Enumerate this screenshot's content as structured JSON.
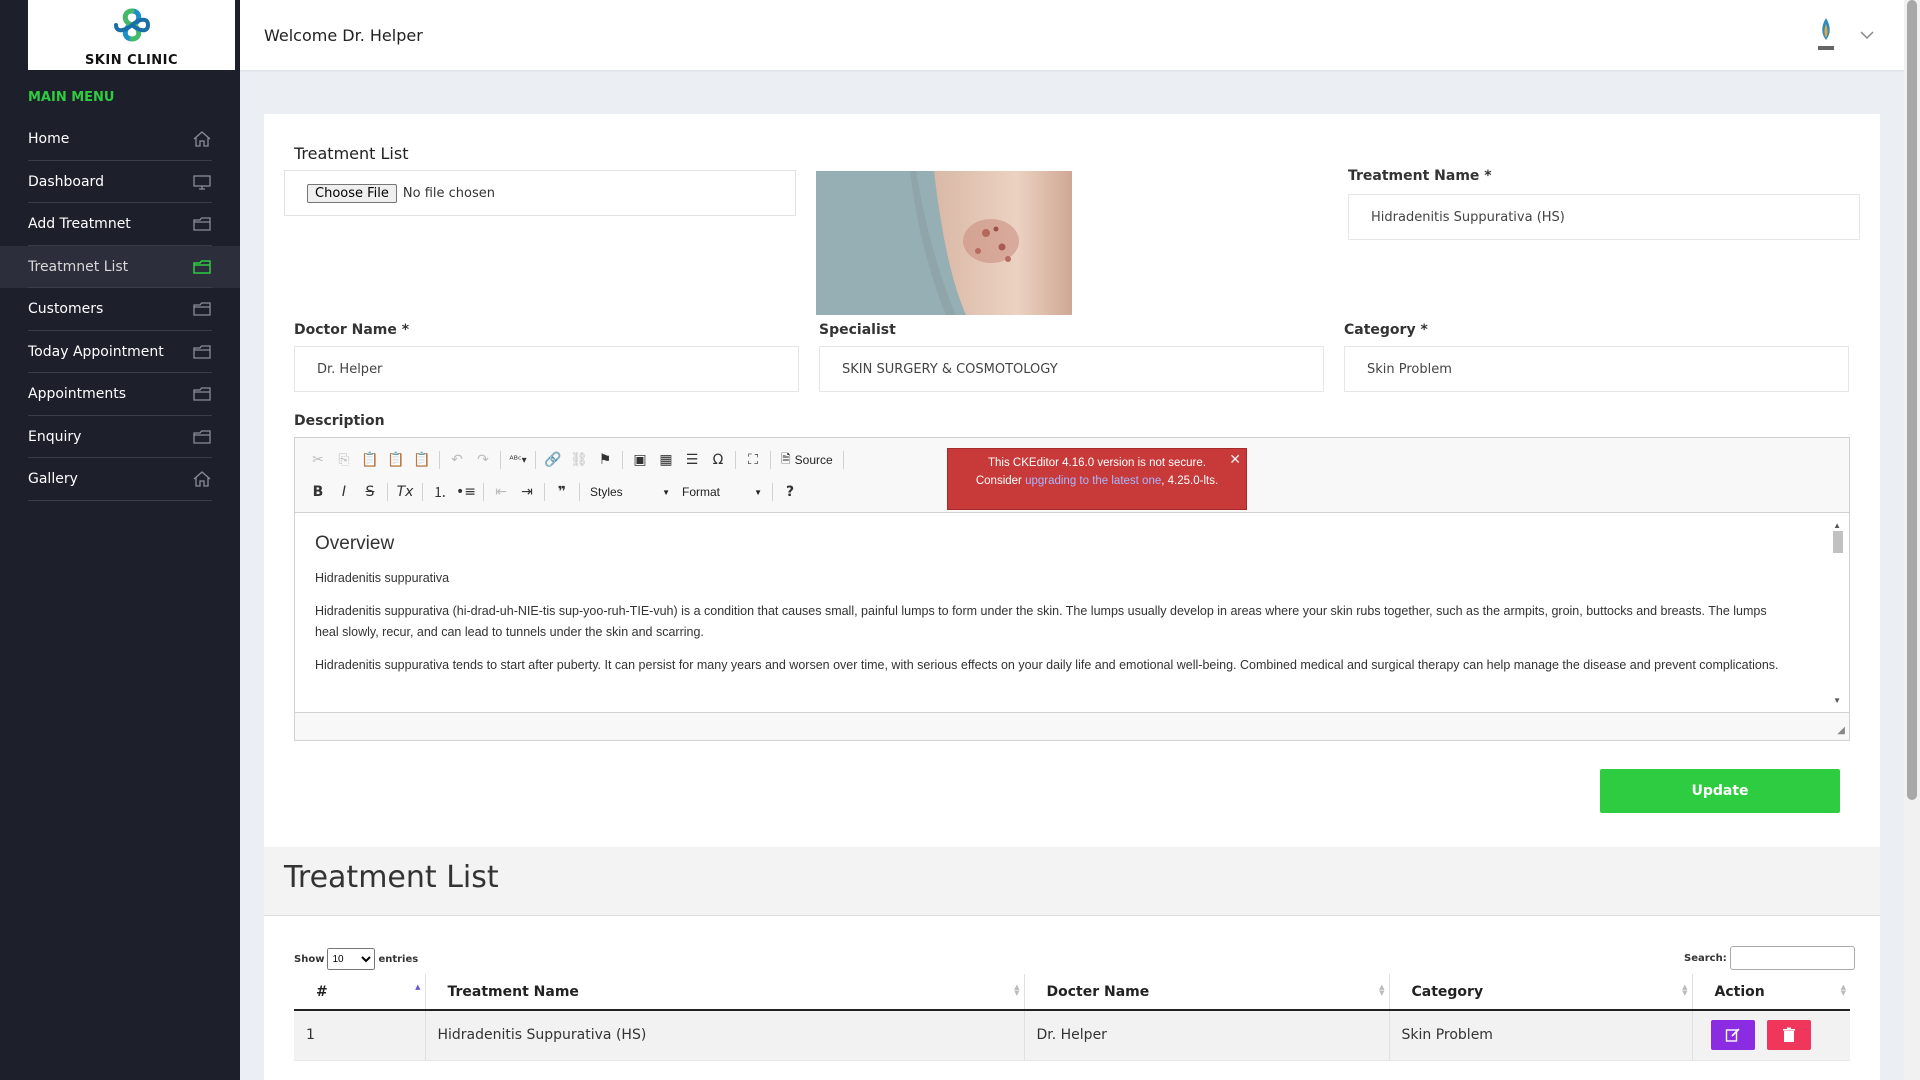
{
  "brand": {
    "name": "SKIN CLINIC"
  },
  "sidebar": {
    "heading": "MAIN MENU",
    "items": [
      {
        "label": "Home",
        "icon": "home-icon"
      },
      {
        "label": "Dashboard",
        "icon": "monitor-icon"
      },
      {
        "label": "Add Treatmnet",
        "icon": "folder-icon"
      },
      {
        "label": "Treatmnet List",
        "icon": "folder-icon",
        "active": true
      },
      {
        "label": "Customers",
        "icon": "folder-icon"
      },
      {
        "label": "Today Appointment",
        "icon": "folder-icon"
      },
      {
        "label": "Appointments",
        "icon": "folder-icon"
      },
      {
        "label": "Enquiry",
        "icon": "folder-icon"
      },
      {
        "label": "Gallery",
        "icon": "home-icon"
      }
    ]
  },
  "header": {
    "welcome": "Welcome Dr. Helper"
  },
  "form": {
    "section_title": "Treatment List",
    "file": {
      "button": "Choose File",
      "status": "No file chosen"
    },
    "treatment_name": {
      "label": "Treatment Name *",
      "value": "Hidradenitis Suppurativa (HS)"
    },
    "doctor_name": {
      "label": "Doctor Name *",
      "value": "Dr. Helper"
    },
    "specialist": {
      "label": "Specialist",
      "value": "SKIN SURGERY & COSMOTOLOGY"
    },
    "category": {
      "label": "Category *",
      "value": "Skin Problem"
    },
    "description": {
      "label": "Description",
      "toolbar": {
        "source": "Source",
        "styles": "Styles",
        "format": "Format"
      },
      "heading": "Overview",
      "paragraphs": [
        "Hidradenitis suppurativa",
        "Hidradenitis suppurativa (hi-drad-uh-NIE-tis sup-yoo-ruh-TIE-vuh) is a condition that causes small, painful lumps to form under the skin. The lumps usually develop in areas where your skin rubs together, such as the armpits, groin, buttocks and breasts. The lumps heal slowly, recur, and can lead to tunnels under the skin and scarring.",
        "Hidradenitis suppurativa tends to start after puberty. It can persist for many years and worsen over time, with serious effects on your daily life and emotional well-being. Combined medical and surgical therapy can help manage the disease and prevent complications."
      ],
      "notice": {
        "line1": "This CKEditor 4.16.0 version is not secure.",
        "prefix": "Consider ",
        "link": "upgrading to the latest one",
        "suffix": ", 4.25.0-lts."
      }
    },
    "update_button": "Update"
  },
  "list": {
    "title": "Treatment List",
    "show_label": "Show",
    "entries_label": "entries",
    "page_size": "10",
    "search_label": "Search:",
    "columns": [
      "#",
      "Treatment Name",
      "Docter Name",
      "Category",
      "Action"
    ],
    "rows": [
      {
        "num": "1",
        "name": "Hidradenitis Suppurativa (HS)",
        "doctor": "Dr. Helper",
        "category": "Skin Problem"
      }
    ]
  },
  "colors": {
    "accent": "#2ecc40",
    "sidebar": "#1d1f2b",
    "edit": "#8b2be2",
    "delete": "#f0365a",
    "notice": "#c83939"
  }
}
